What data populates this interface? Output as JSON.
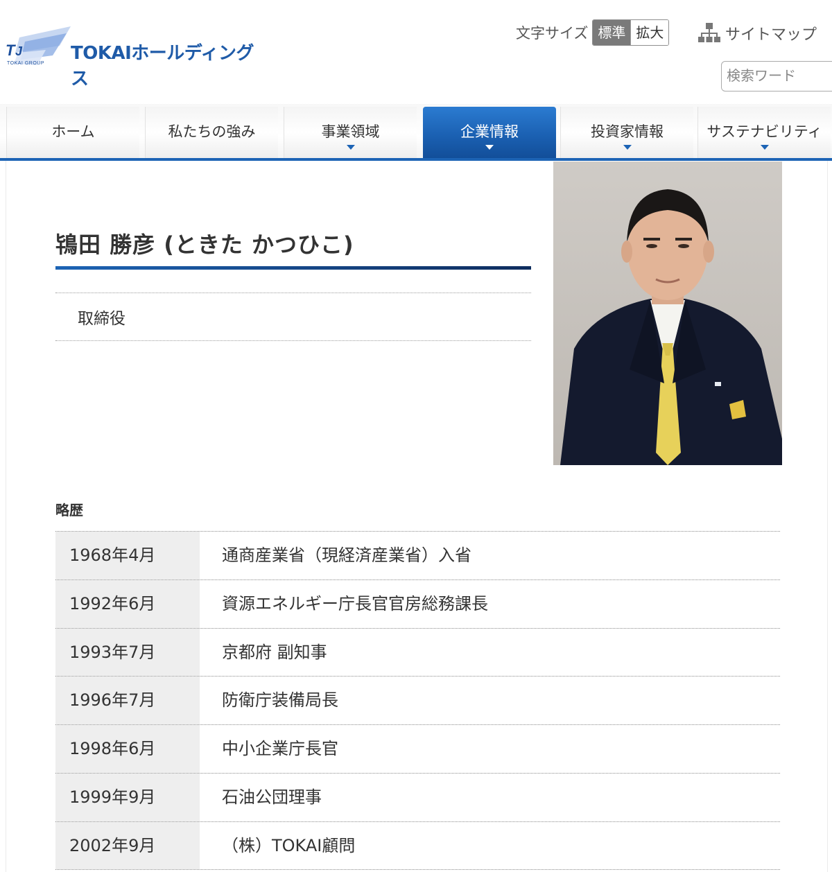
{
  "header": {
    "logo_text": "TOKAIホールディングス",
    "logo_small": "TOKAI GROUP",
    "fontsize_label": "文字サイズ",
    "fontsize_standard": "標準",
    "fontsize_large": "拡大",
    "sitemap_label": "サイトマップ",
    "search_placeholder": "検索ワード",
    "brand_color": "#1f5ba8"
  },
  "nav": {
    "items": [
      {
        "label": "ホーム",
        "has_menu": false,
        "active": false
      },
      {
        "label": "私たちの強み",
        "has_menu": false,
        "active": false
      },
      {
        "label": "事業領域",
        "has_menu": true,
        "active": false
      },
      {
        "label": "企業情報",
        "has_menu": true,
        "active": true
      },
      {
        "label": "投資家情報",
        "has_menu": true,
        "active": false
      },
      {
        "label": "サステナビリティ",
        "has_menu": true,
        "active": false
      }
    ],
    "active_color": "#1a5fb0"
  },
  "profile": {
    "name": "鴇田 勝彦 (ときた かつひこ)",
    "position": "取締役"
  },
  "career": {
    "heading": "略歴",
    "rows": [
      {
        "date": "1968年4月",
        "desc": "通商産業省（現経済産業省）入省"
      },
      {
        "date": "1992年6月",
        "desc": "資源エネルギー庁長官官房総務課長"
      },
      {
        "date": "1993年7月",
        "desc": "京都府 副知事"
      },
      {
        "date": "1996年7月",
        "desc": "防衛庁装備局長"
      },
      {
        "date": "1998年6月",
        "desc": "中小企業庁長官"
      },
      {
        "date": "1999年9月",
        "desc": "石油公団理事"
      },
      {
        "date": "2002年9月",
        "desc": "（株）TOKAI顧問"
      }
    ]
  }
}
